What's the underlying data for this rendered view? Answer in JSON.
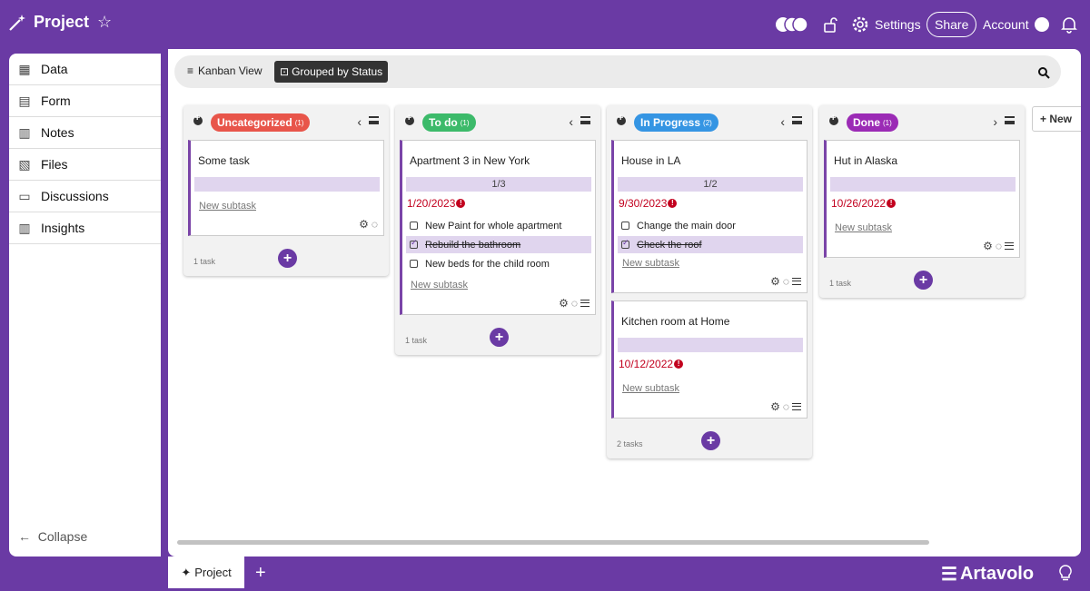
{
  "header": {
    "title": "Project",
    "settings_label": "Settings",
    "share_label": "Share",
    "account_label": "Account"
  },
  "sidebar": {
    "items": [
      {
        "label": "Data",
        "icon": "table-icon"
      },
      {
        "label": "Form",
        "icon": "form-icon"
      },
      {
        "label": "Notes",
        "icon": "notes-icon"
      },
      {
        "label": "Files",
        "icon": "files-icon"
      },
      {
        "label": "Discussions",
        "icon": "discussions-icon"
      },
      {
        "label": "Insights",
        "icon": "insights-icon"
      }
    ],
    "collapse_label": "Collapse"
  },
  "toolbar": {
    "view_label": "Kanban View",
    "group_label": "Grouped by Status"
  },
  "columns": [
    {
      "title": "Uncategorized",
      "count": "(1)",
      "color": "#e8554a",
      "chev": "‹",
      "footer": "1 task",
      "cards": [
        {
          "title": "Some task",
          "newsub": "New subtask"
        }
      ]
    },
    {
      "title": "To do",
      "count": "(1)",
      "color": "#3cba6a",
      "chev": "‹",
      "footer": "1 task",
      "cards": [
        {
          "title": "Apartment 3 in New York",
          "progress": "1/3",
          "due": "1/20/2023",
          "subtasks": [
            {
              "text": "New Paint for whole apartment",
              "done": false
            },
            {
              "text": "Rebuild the bathroom",
              "done": true
            },
            {
              "text": "New beds for the child room",
              "done": false
            }
          ],
          "newsub": "New subtask"
        }
      ]
    },
    {
      "title": "In Progress",
      "count": "(2)",
      "color": "#3595e3",
      "chev": "‹",
      "footer": "2 tasks",
      "cards": [
        {
          "title": "House in LA",
          "progress": "1/2",
          "due": "9/30/2023",
          "subtasks": [
            {
              "text": "Change the main door",
              "done": false
            },
            {
              "text": "Check the roof",
              "done": true
            }
          ],
          "newsub": "New subtask"
        },
        {
          "title": "Kitchen room at Home",
          "due": "10/12/2022",
          "newsub": "New subtask"
        }
      ]
    },
    {
      "title": "Done",
      "count": "(1)",
      "color": "#9b2bb5",
      "chev": "›",
      "footer": "1 task",
      "cards": [
        {
          "title": "Hut in Alaska",
          "due": "10/26/2022",
          "newsub": "New subtask"
        }
      ]
    }
  ],
  "new_column_label": "+ New",
  "bottom": {
    "tab_label": "Project",
    "add_tab": "+",
    "brand": "Artavolo"
  }
}
